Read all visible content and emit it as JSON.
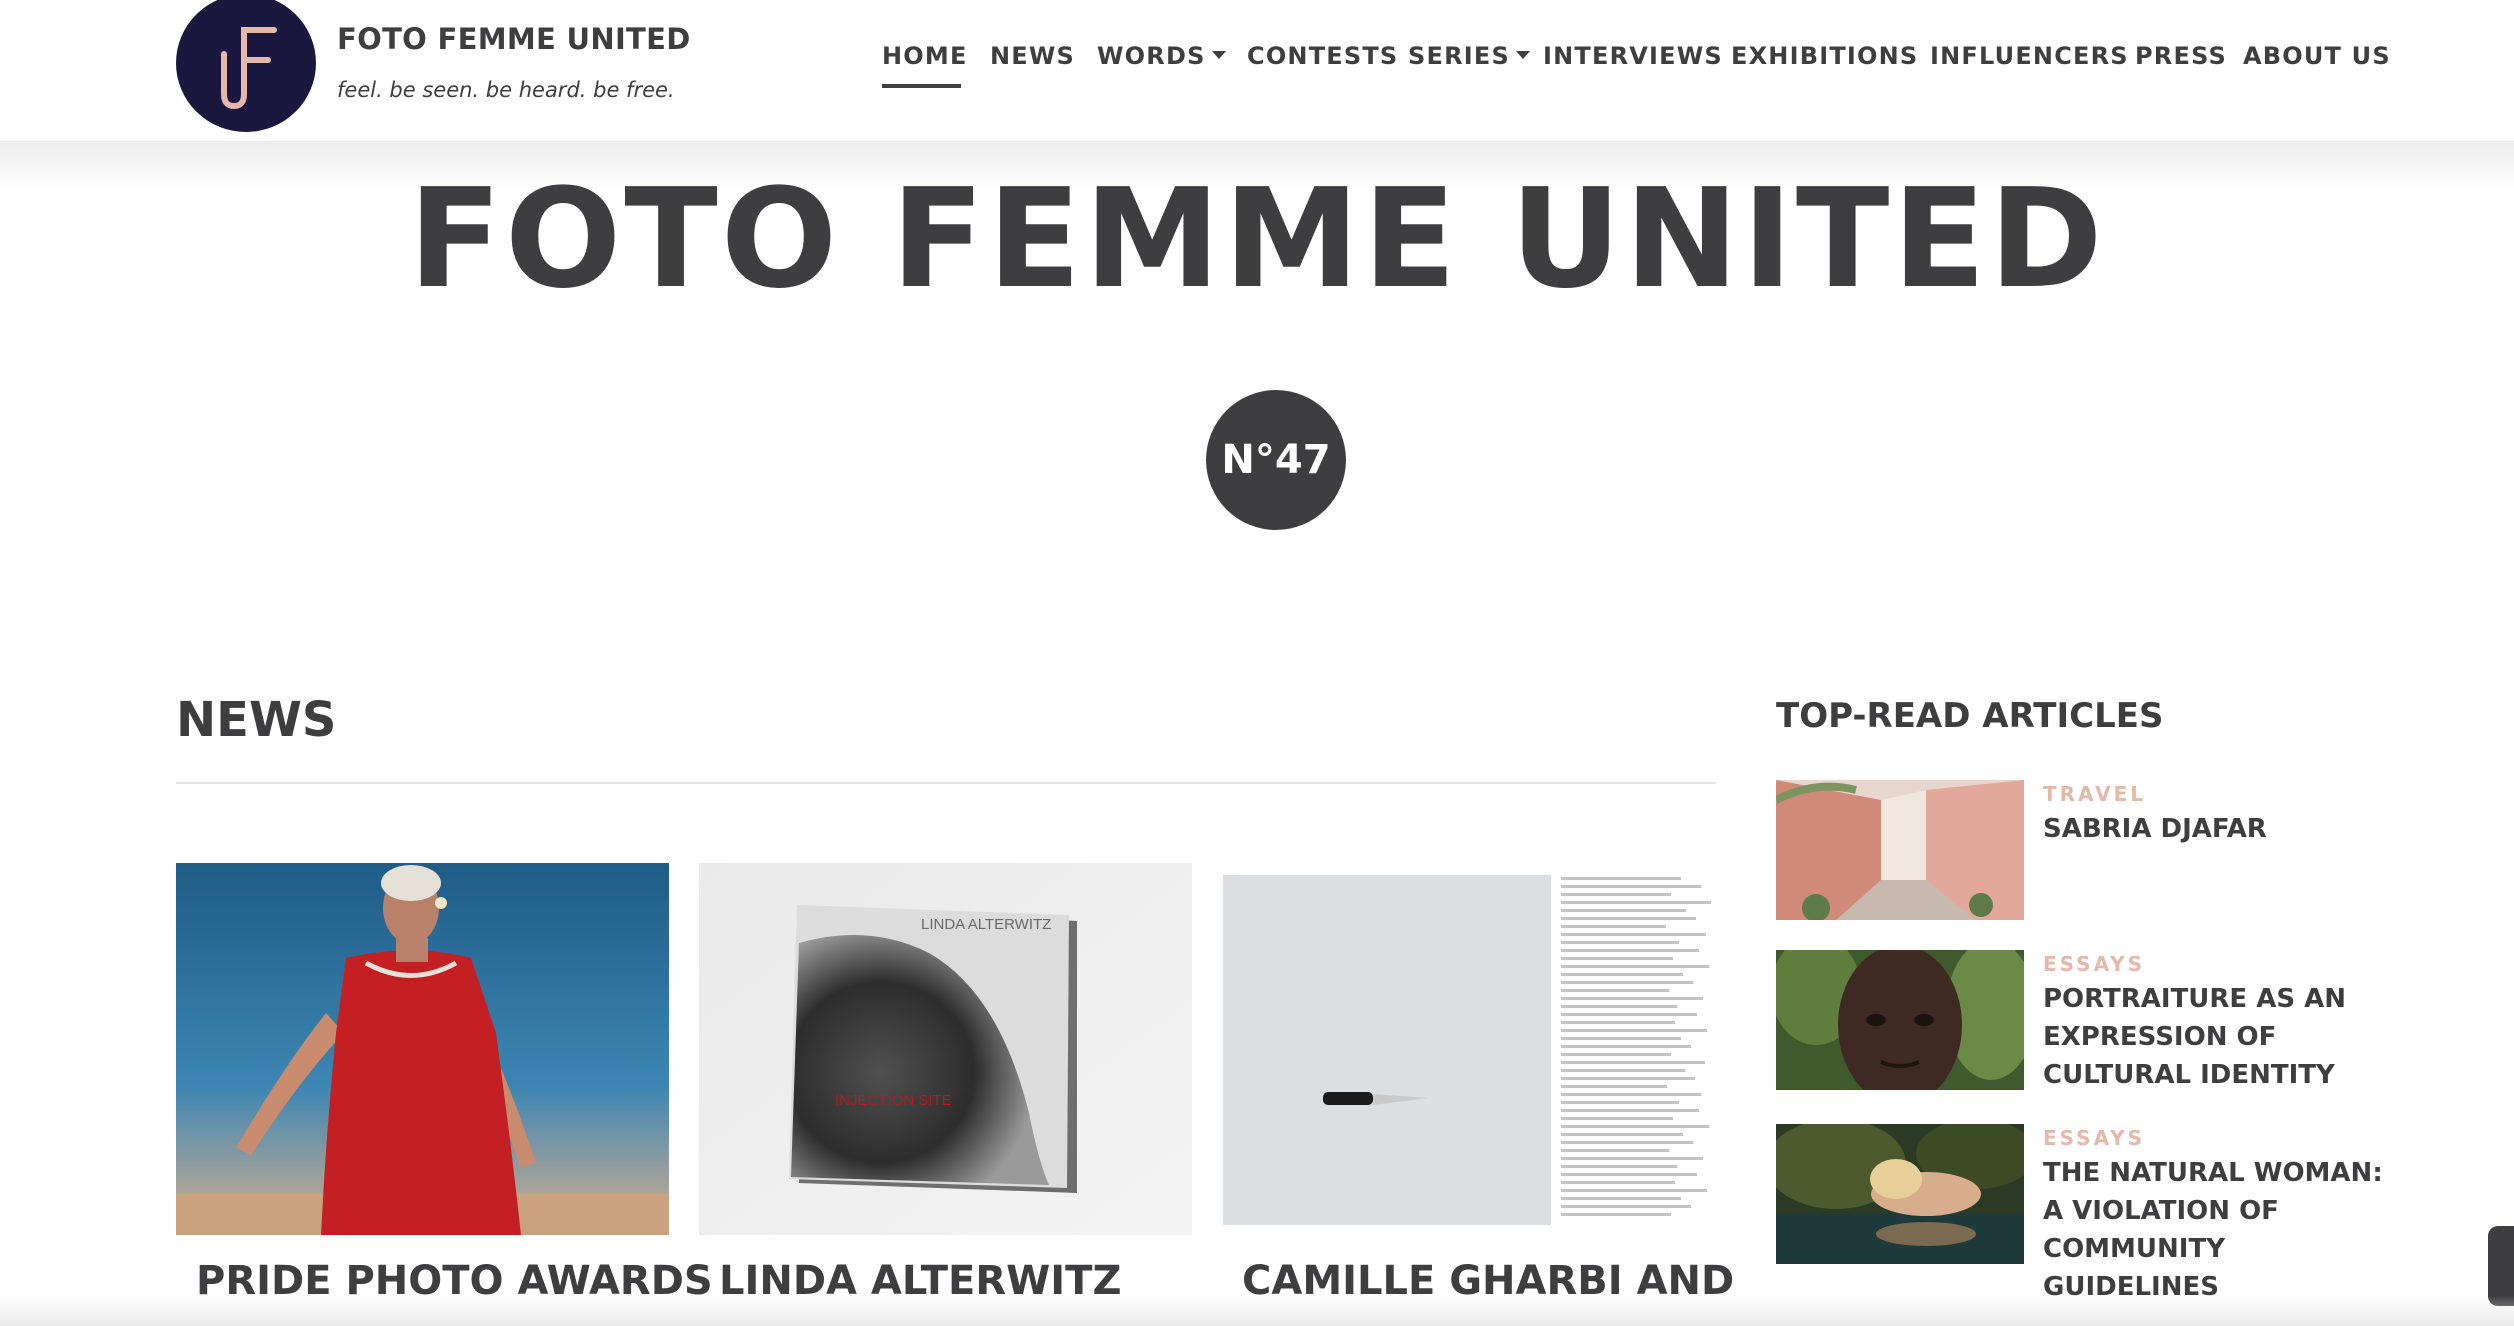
{
  "header": {
    "site_title": "FOTO FEMME UNITED",
    "tagline": "feel. be seen. be heard. be free.",
    "nav": [
      {
        "label": "HOME",
        "active": true
      },
      {
        "label": "NEWS"
      },
      {
        "label": "WORDS",
        "dropdown": true
      },
      {
        "label": "CONTESTS"
      },
      {
        "label": "SERIES",
        "dropdown": true
      },
      {
        "label": "INTERVIEWS"
      },
      {
        "label": "EXHIBITIONS"
      },
      {
        "label": "INFLUENCERS"
      },
      {
        "label": "PRESS"
      },
      {
        "label": "ABOUT US"
      }
    ]
  },
  "hero": {
    "title": "FOTO FEMME UNITED",
    "issue": "N°47"
  },
  "news": {
    "heading": "NEWS",
    "cards": [
      {
        "title": "PRIDE PHOTO AWARDS"
      },
      {
        "title": "LINDA ALTERWITZ",
        "book_author": "LINDA ALTERWITZ",
        "book_title": "INJECTION SITE"
      },
      {
        "title": "CAMILLE GHARBI AND"
      }
    ]
  },
  "sidebar": {
    "heading": "TOP-READ ARTICLES",
    "articles": [
      {
        "category": "TRAVEL",
        "title": "SABRIA DJAFAR"
      },
      {
        "category": "ESSAYS",
        "title": "PORTRAITURE AS AN EXPRESSION OF CULTURAL IDENTITY"
      },
      {
        "category": "ESSAYS",
        "title": "THE NATURAL WOMAN: A VIOLATION OF COMMUNITY GUIDELINES"
      }
    ]
  },
  "colors": {
    "text": "#3e3e40",
    "logo_bg": "#1b1840",
    "logo_mark": "#e6b8ab",
    "category": "#e5b8a8"
  }
}
